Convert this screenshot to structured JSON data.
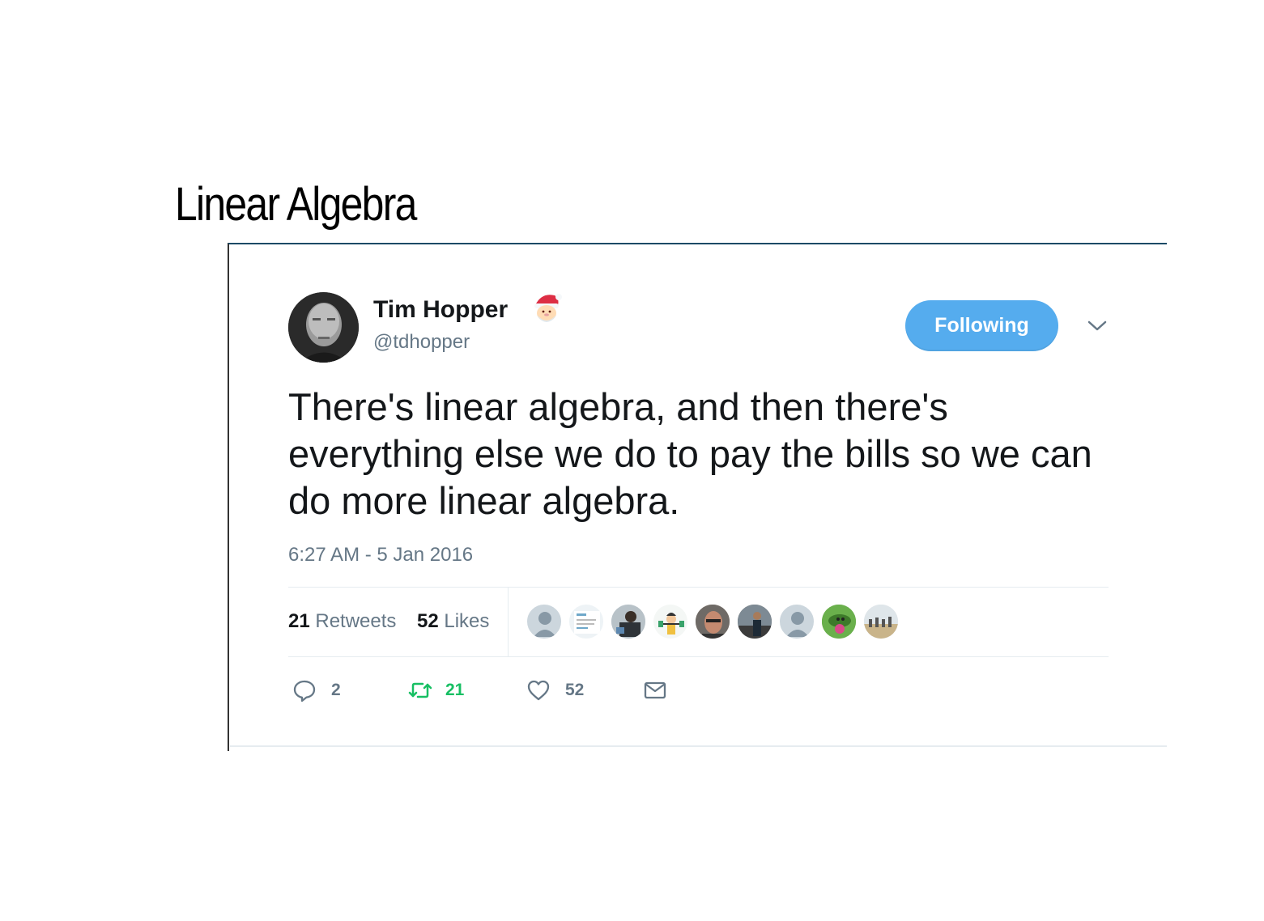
{
  "slide": {
    "title": "Linear Algebra"
  },
  "tweet": {
    "author_name": "Tim Hopper",
    "author_handle": "@tdhopper",
    "name_emoji_icon": "santa-icon",
    "follow_button_label": "Following",
    "text": "There's linear algebra, and then there's everything else we do to pay the bills so we can do more linear algebra.",
    "timestamp": "6:27 AM - 5 Jan 2016",
    "stats": {
      "retweets_count": "21",
      "retweets_label": "Retweets",
      "likes_count": "52",
      "likes_label": "Likes"
    },
    "liker_avatar_count": 9,
    "actions": {
      "reply_count": "2",
      "retweet_count": "21",
      "like_count": "52"
    }
  },
  "colors": {
    "follow_button": "#55acee",
    "retweet_green": "#17bf63",
    "secondary_text": "#657786",
    "primary_text": "#14171a",
    "divider": "#e6ecf0"
  }
}
